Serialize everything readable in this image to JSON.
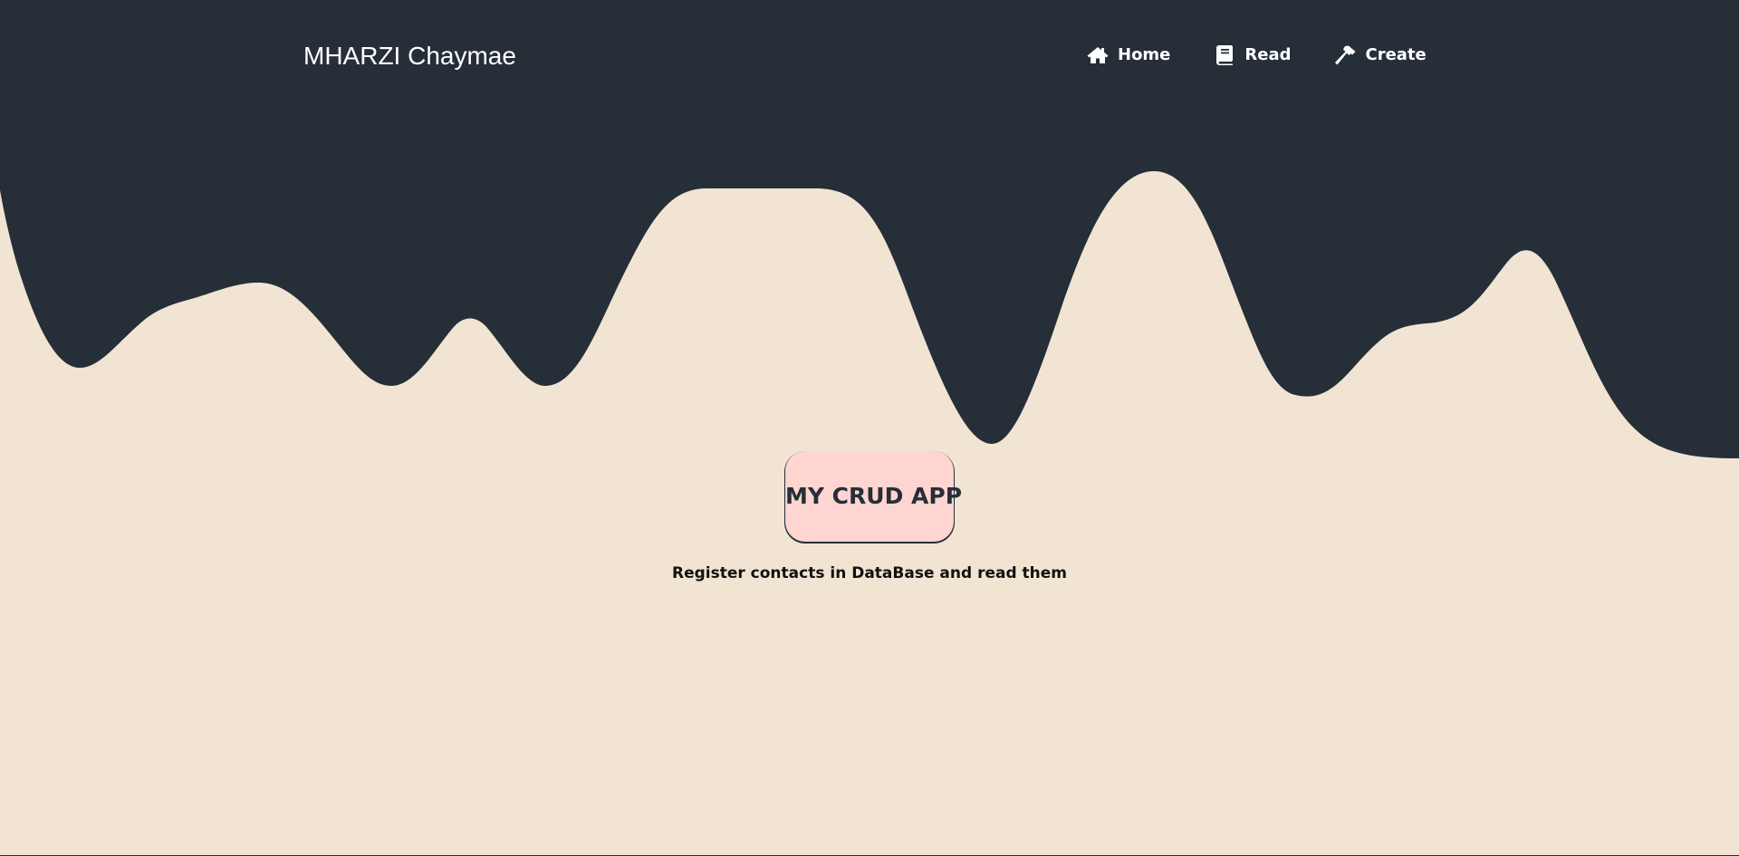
{
  "navbar": {
    "brand": "MHARZI Chaymae",
    "links": [
      {
        "label": "Home",
        "icon": "home-icon"
      },
      {
        "label": "Read",
        "icon": "book-icon"
      },
      {
        "label": "Create",
        "icon": "hammer-icon"
      }
    ]
  },
  "hero": {
    "title": "MY CRUD APP",
    "subtitle": "Register contacts in DataBase and read them"
  },
  "colors": {
    "dark": "#262e38",
    "background": "#f1e4d2",
    "title_badge": "#ffd5d1",
    "nav_text": "#ffffff"
  }
}
